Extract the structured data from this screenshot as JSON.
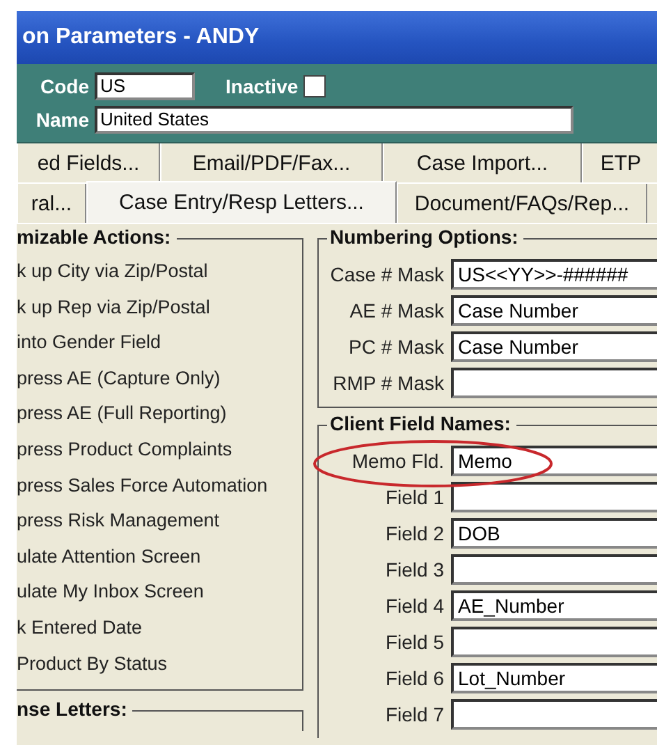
{
  "window": {
    "title": "on Parameters - ANDY"
  },
  "header": {
    "code_label": "Code",
    "code_value": "US",
    "inactive_label": "Inactive",
    "inactive_checked": false,
    "name_label": "Name",
    "name_value": "United States"
  },
  "tab_rows": [
    {
      "tabs": [
        {
          "label": "ed Fields...",
          "selected": false
        },
        {
          "label": "Email/PDF/Fax...",
          "selected": false
        },
        {
          "label": "Case Import...",
          "selected": false
        },
        {
          "label": "ETP",
          "selected": false
        }
      ]
    },
    {
      "tabs": [
        {
          "label": "ral...",
          "selected": false
        },
        {
          "label": "Case Entry/Resp Letters...",
          "selected": true
        },
        {
          "label": "Document/FAQs/Rep...",
          "selected": false
        }
      ]
    }
  ],
  "actions_group": {
    "title": "mizable Actions:",
    "items": [
      "k up City via Zip/Postal",
      "k up Rep via Zip/Postal",
      "into Gender Field",
      "press AE (Capture Only)",
      "press AE (Full Reporting)",
      "press Product Complaints",
      "press Sales Force Automation",
      "press Risk Management",
      "ulate Attention Screen",
      "ulate My Inbox Screen",
      "k Entered Date",
      "Product By Status"
    ]
  },
  "letters_group": {
    "title": "nse Letters:"
  },
  "numbering_group": {
    "title": "Numbering Options:",
    "fields": [
      {
        "label": "Case # Mask",
        "value": "US<<YY>>-######"
      },
      {
        "label": "AE # Mask",
        "value": "Case Number"
      },
      {
        "label": "PC # Mask",
        "value": "Case Number"
      },
      {
        "label": "RMP # Mask"
      }
    ]
  },
  "client_group": {
    "title": "Client Field Names:",
    "fields": [
      {
        "label": "Memo Fld.",
        "value": "Memo",
        "highlighted": true
      },
      {
        "label": "Field 1",
        "highlighted": false
      },
      {
        "label": "Field 2",
        "value": "DOB",
        "highlighted": false
      },
      {
        "label": "Field 3",
        "highlighted": false
      },
      {
        "label": "Field 4",
        "value": "AE_Number",
        "highlighted": false
      },
      {
        "label": "Field 5",
        "highlighted": false
      },
      {
        "label": "Field 6",
        "value": "Lot_Number",
        "highlighted": false
      },
      {
        "label": "Field 7",
        "highlighted": false
      }
    ]
  }
}
